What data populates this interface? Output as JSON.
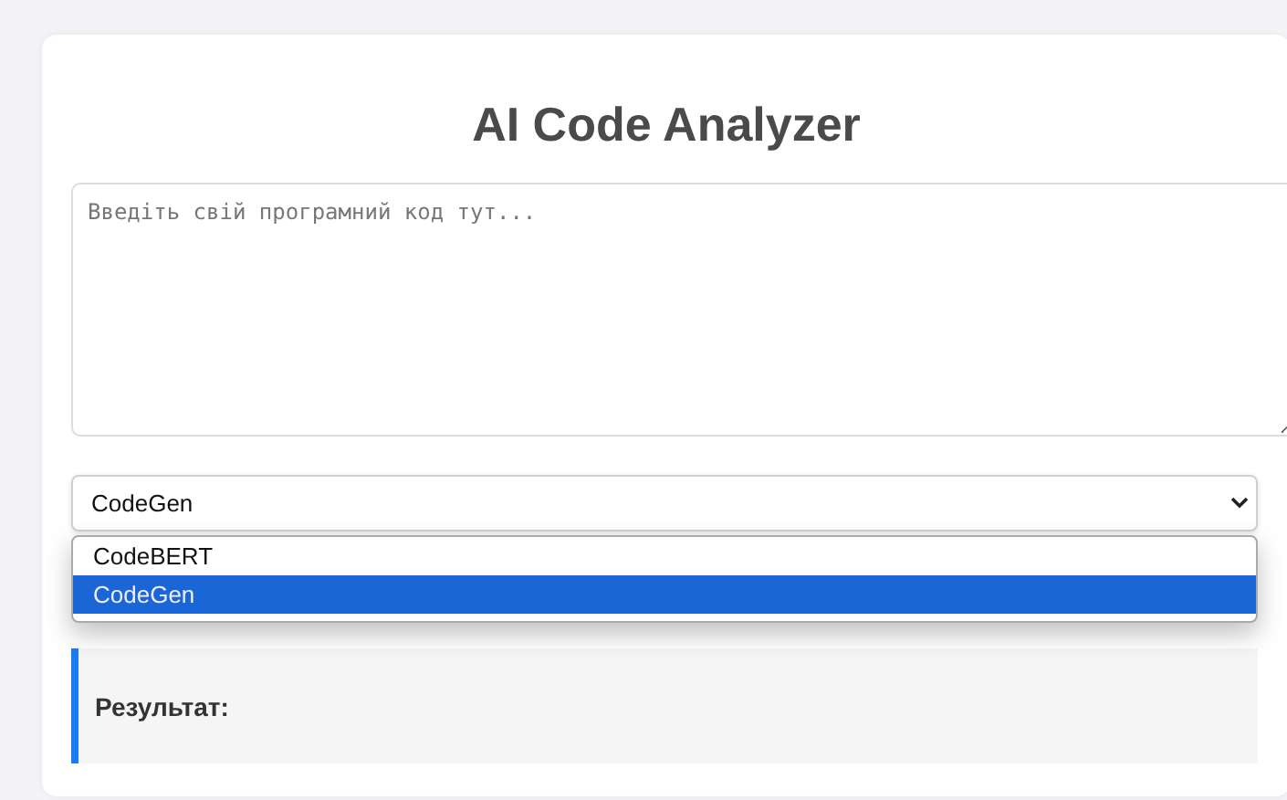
{
  "title": "AI Code Analyzer",
  "code_input": {
    "placeholder": "Введіть свій програмний код тут..."
  },
  "model_select": {
    "value": "CodeGen",
    "expanded": true,
    "options": [
      {
        "label": "CodeBERT",
        "selected": false
      },
      {
        "label": "CodeGen",
        "selected": true
      }
    ]
  },
  "result": {
    "label": "Результат:"
  }
}
